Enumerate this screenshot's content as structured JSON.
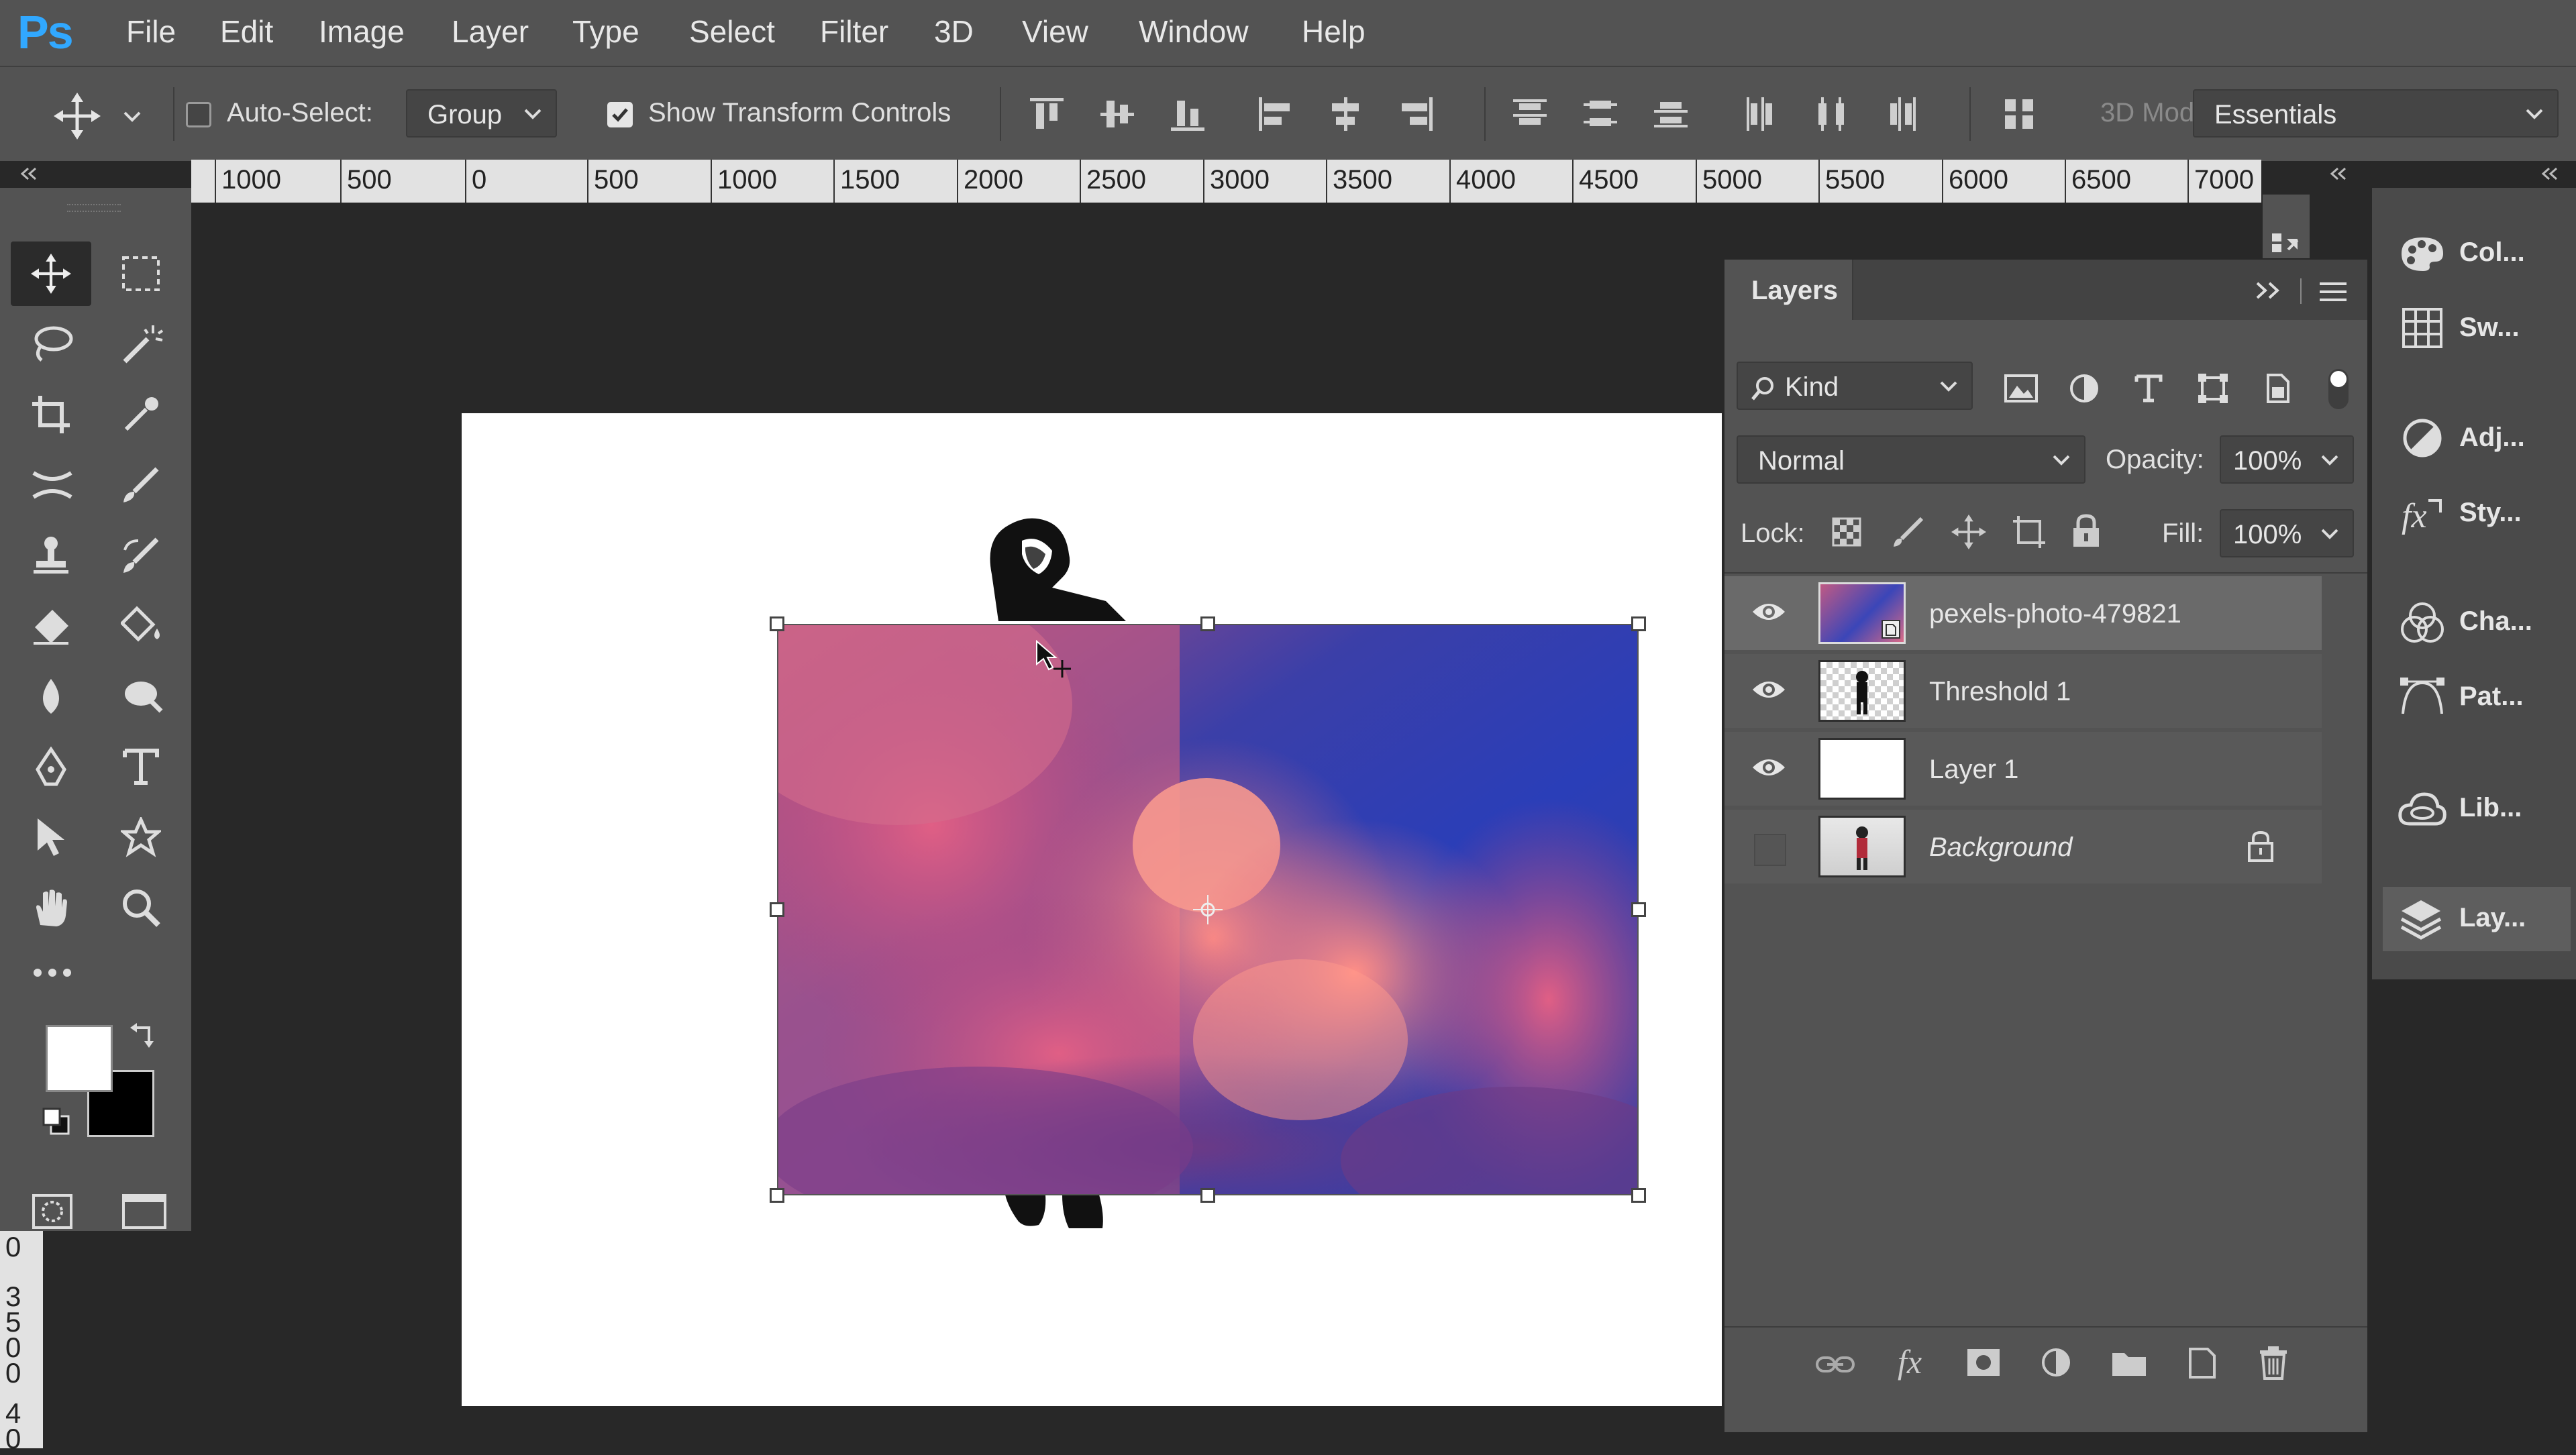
{
  "app": {
    "logo": "Ps"
  },
  "menu": [
    "File",
    "Edit",
    "Image",
    "Layer",
    "Type",
    "Select",
    "Filter",
    "3D",
    "View",
    "Window",
    "Help"
  ],
  "options": {
    "auto_select_label": "Auto-Select:",
    "auto_select_checked": false,
    "auto_select_value": "Group",
    "show_transform_label": "Show Transform Controls",
    "show_transform_checked": true,
    "mode_3d_label": "3D Mod",
    "workspace": "Essentials"
  },
  "ruler": {
    "h_labels": [
      "1000",
      "500",
      "0",
      "500",
      "1000",
      "1500",
      "2000",
      "2500",
      "3000",
      "3500",
      "4000",
      "4500",
      "5000",
      "5500",
      "6000",
      "6500",
      "7000"
    ],
    "v_labels": [
      "0",
      "3",
      "5",
      "0",
      "0",
      "4",
      "0"
    ]
  },
  "layers_panel": {
    "tab": "Layers",
    "filter_kind": "Kind",
    "blend_mode": "Normal",
    "opacity_label": "Opacity:",
    "opacity_value": "100%",
    "lock_label": "Lock:",
    "fill_label": "Fill:",
    "fill_value": "100%",
    "layers": [
      {
        "name": "pexels-photo-479821",
        "visible": true,
        "selected": true
      },
      {
        "name": "Threshold 1",
        "visible": true,
        "selected": false
      },
      {
        "name": "Layer 1",
        "visible": true,
        "selected": false
      },
      {
        "name": "Background",
        "visible": false,
        "selected": false,
        "locked": true
      }
    ]
  },
  "right_strip": [
    "Col...",
    "Sw...",
    "Adj...",
    "Sty...",
    "Cha...",
    "Pat...",
    "Lib...",
    "Lay..."
  ],
  "colors": {
    "foreground": "#ffffff",
    "background": "#000000",
    "accent": "#31a8ff"
  }
}
